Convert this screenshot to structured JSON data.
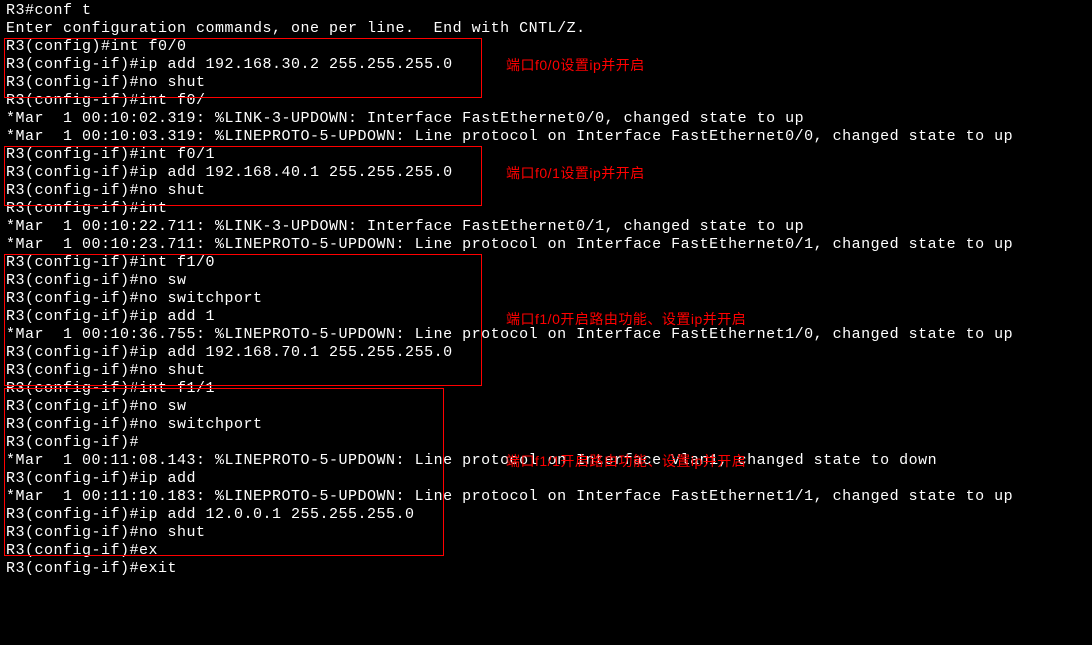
{
  "terminal": {
    "lines": [
      "R3#conf t",
      "Enter configuration commands, one per line.  End with CNTL/Z.",
      "R3(config)#int f0/0",
      "R3(config-if)#ip add 192.168.30.2 255.255.255.0",
      "R3(config-if)#no shut",
      "R3(config-if)#int f0/",
      "*Mar  1 00:10:02.319: %LINK-3-UPDOWN: Interface FastEthernet0/0, changed state to up",
      "*Mar  1 00:10:03.319: %LINEPROTO-5-UPDOWN: Line protocol on Interface FastEthernet0/0, changed state to up",
      "R3(config-if)#int f0/1",
      "R3(config-if)#ip add 192.168.40.1 255.255.255.0",
      "R3(config-if)#no shut",
      "R3(config-if)#int",
      "*Mar  1 00:10:22.711: %LINK-3-UPDOWN: Interface FastEthernet0/1, changed state to up",
      "*Mar  1 00:10:23.711: %LINEPROTO-5-UPDOWN: Line protocol on Interface FastEthernet0/1, changed state to up",
      "R3(config-if)#int f1/0",
      "R3(config-if)#no sw",
      "R3(config-if)#no switchport",
      "R3(config-if)#ip add 1",
      "*Mar  1 00:10:36.755: %LINEPROTO-5-UPDOWN: Line protocol on Interface FastEthernet1/0, changed state to up",
      "R3(config-if)#ip add 192.168.70.1 255.255.255.0",
      "R3(config-if)#no shut",
      "R3(config-if)#int f1/1",
      "R3(config-if)#no sw",
      "R3(config-if)#no switchport",
      "R3(config-if)#",
      "*Mar  1 00:11:08.143: %LINEPROTO-5-UPDOWN: Line protocol on Interface Vlan1, changed state to down",
      "R3(config-if)#ip add",
      "*Mar  1 00:11:10.183: %LINEPROTO-5-UPDOWN: Line protocol on Interface FastEthernet1/1, changed state to up",
      "R3(config-if)#ip add 12.0.0.1 255.255.255.0",
      "R3(config-if)#no shut",
      "R3(config-if)#ex",
      "R3(config-if)#exit"
    ]
  },
  "annotations": {
    "a1": "端口f0/0设置ip并开启",
    "a2": "端口f0/1设置ip并开启",
    "a3": "端口f1/0开启路由功能、设置ip并开启",
    "a4": "端口f1/1开启路由功能、设置ip并开启"
  }
}
